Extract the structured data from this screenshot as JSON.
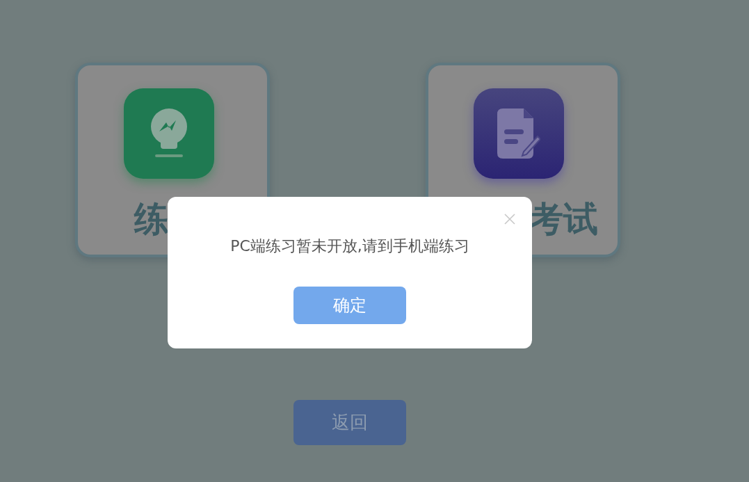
{
  "cards": [
    {
      "kind": "practice",
      "label": "练"
    },
    {
      "kind": "exam",
      "label": "考试"
    }
  ],
  "back_button": {
    "label": "返回"
  },
  "dialog": {
    "message": "PC端练习暂未开放,请到手机端练习",
    "confirm_button": "确定"
  }
}
